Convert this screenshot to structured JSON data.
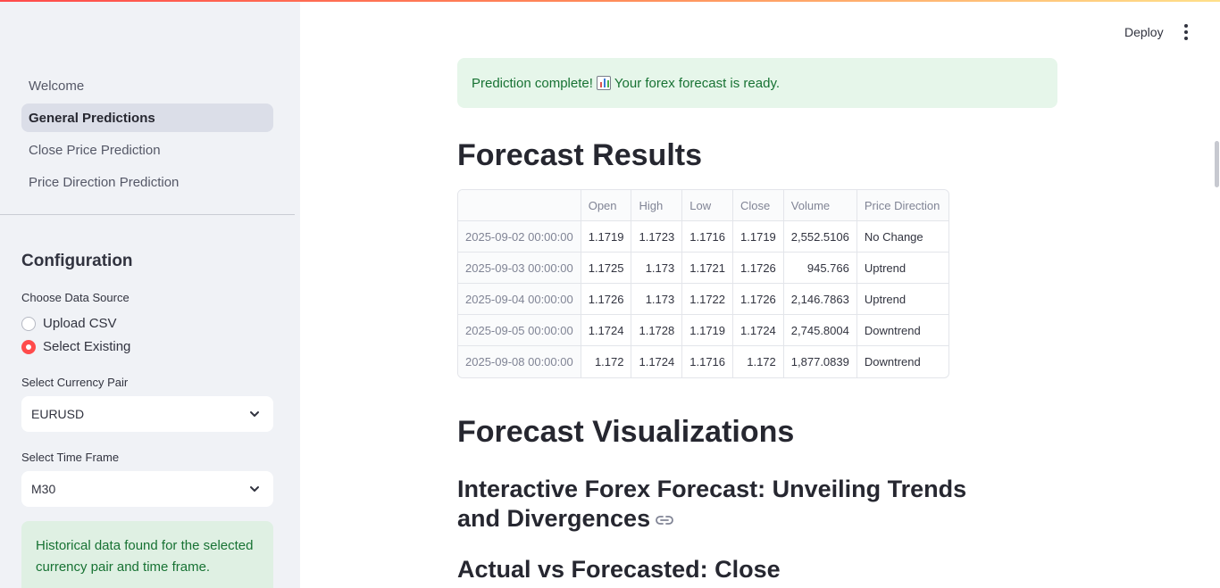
{
  "sidebar": {
    "nav": [
      {
        "label": "Welcome",
        "active": false
      },
      {
        "label": "General Predictions",
        "active": true
      },
      {
        "label": "Close Price Prediction",
        "active": false
      },
      {
        "label": "Price Direction Prediction",
        "active": false
      }
    ],
    "config_title": "Configuration",
    "data_source_label": "Choose Data Source",
    "data_source_options": [
      "Upload CSV",
      "Select Existing"
    ],
    "data_source_selected": "Select Existing",
    "currency_label": "Select Currency Pair",
    "currency_value": "EURUSD",
    "timeframe_label": "Select Time Frame",
    "timeframe_value": "M30",
    "info_message": "Historical data found for the selected currency pair and time frame."
  },
  "header": {
    "deploy_label": "Deploy",
    "menu_icon": "more-vertical-icon"
  },
  "main": {
    "success_before": "Prediction complete!",
    "success_emoji": "bar-chart-icon",
    "success_after": "Your forex forecast is ready.",
    "forecast_title": "Forecast Results",
    "table": {
      "columns": [
        "",
        "Open",
        "High",
        "Low",
        "Close",
        "Volume",
        "Price Direction"
      ],
      "rows": [
        [
          "2025-09-02 00:00:00",
          "1.1719",
          "1.1723",
          "1.1716",
          "1.1719",
          "2,552.5106",
          "No Change"
        ],
        [
          "2025-09-03 00:00:00",
          "1.1725",
          "1.173",
          "1.1721",
          "1.1726",
          "945.766",
          "Uptrend"
        ],
        [
          "2025-09-04 00:00:00",
          "1.1726",
          "1.173",
          "1.1722",
          "1.1726",
          "2,146.7863",
          "Uptrend"
        ],
        [
          "2025-09-05 00:00:00",
          "1.1724",
          "1.1728",
          "1.1719",
          "1.1724",
          "2,745.8004",
          "Downtrend"
        ],
        [
          "2025-09-08 00:00:00",
          "1.172",
          "1.1724",
          "1.1716",
          "1.172",
          "1,877.0839",
          "Downtrend"
        ]
      ]
    },
    "viz_title": "Forecast Visualizations",
    "interactive_title": "Interactive Forex Forecast: Unveiling Trends and Divergences",
    "actual_vs_title": "Actual vs Forecasted: Close"
  },
  "colors": {
    "accent": "#ff4b4b",
    "success_bg": "#e6f6ea",
    "success_text": "#177233",
    "sidebar_bg": "#f0f2f6"
  }
}
